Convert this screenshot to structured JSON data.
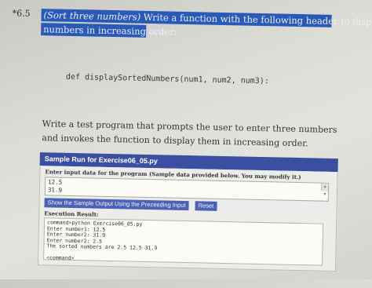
{
  "exercise": {
    "number": "*6.5",
    "title_italic": "(Sort three numbers)",
    "title_rest": " Write a function with the following header to display three",
    "title_line2": "numbers in increasing order:"
  },
  "code_header": "def displaySortedNumbers(num1, num2, num3):",
  "paragraph": "Write a test program that prompts the user to enter three numbers and invokes the function to display them in increasing order.",
  "sample_run": {
    "header": "Sample Run for Exercise06_05.py",
    "instruction": "Enter input data for the program (Sample data provided below. You may modify it.)",
    "input_lines": [
      "12.5",
      "31.9"
    ],
    "buttons": {
      "show_output": "Show the Sample Output Using the Preceeding Input",
      "reset": "Reset"
    },
    "result_title": "Execution Result:",
    "result_lines": [
      "command>python Exercise06_05.py",
      "Enter number1: 12.5",
      "Enter number2: 31.9",
      "Enter number2: 2.5",
      "The sorted numbers are 2.5 12.5 31.9",
      "",
      "<command>"
    ]
  }
}
